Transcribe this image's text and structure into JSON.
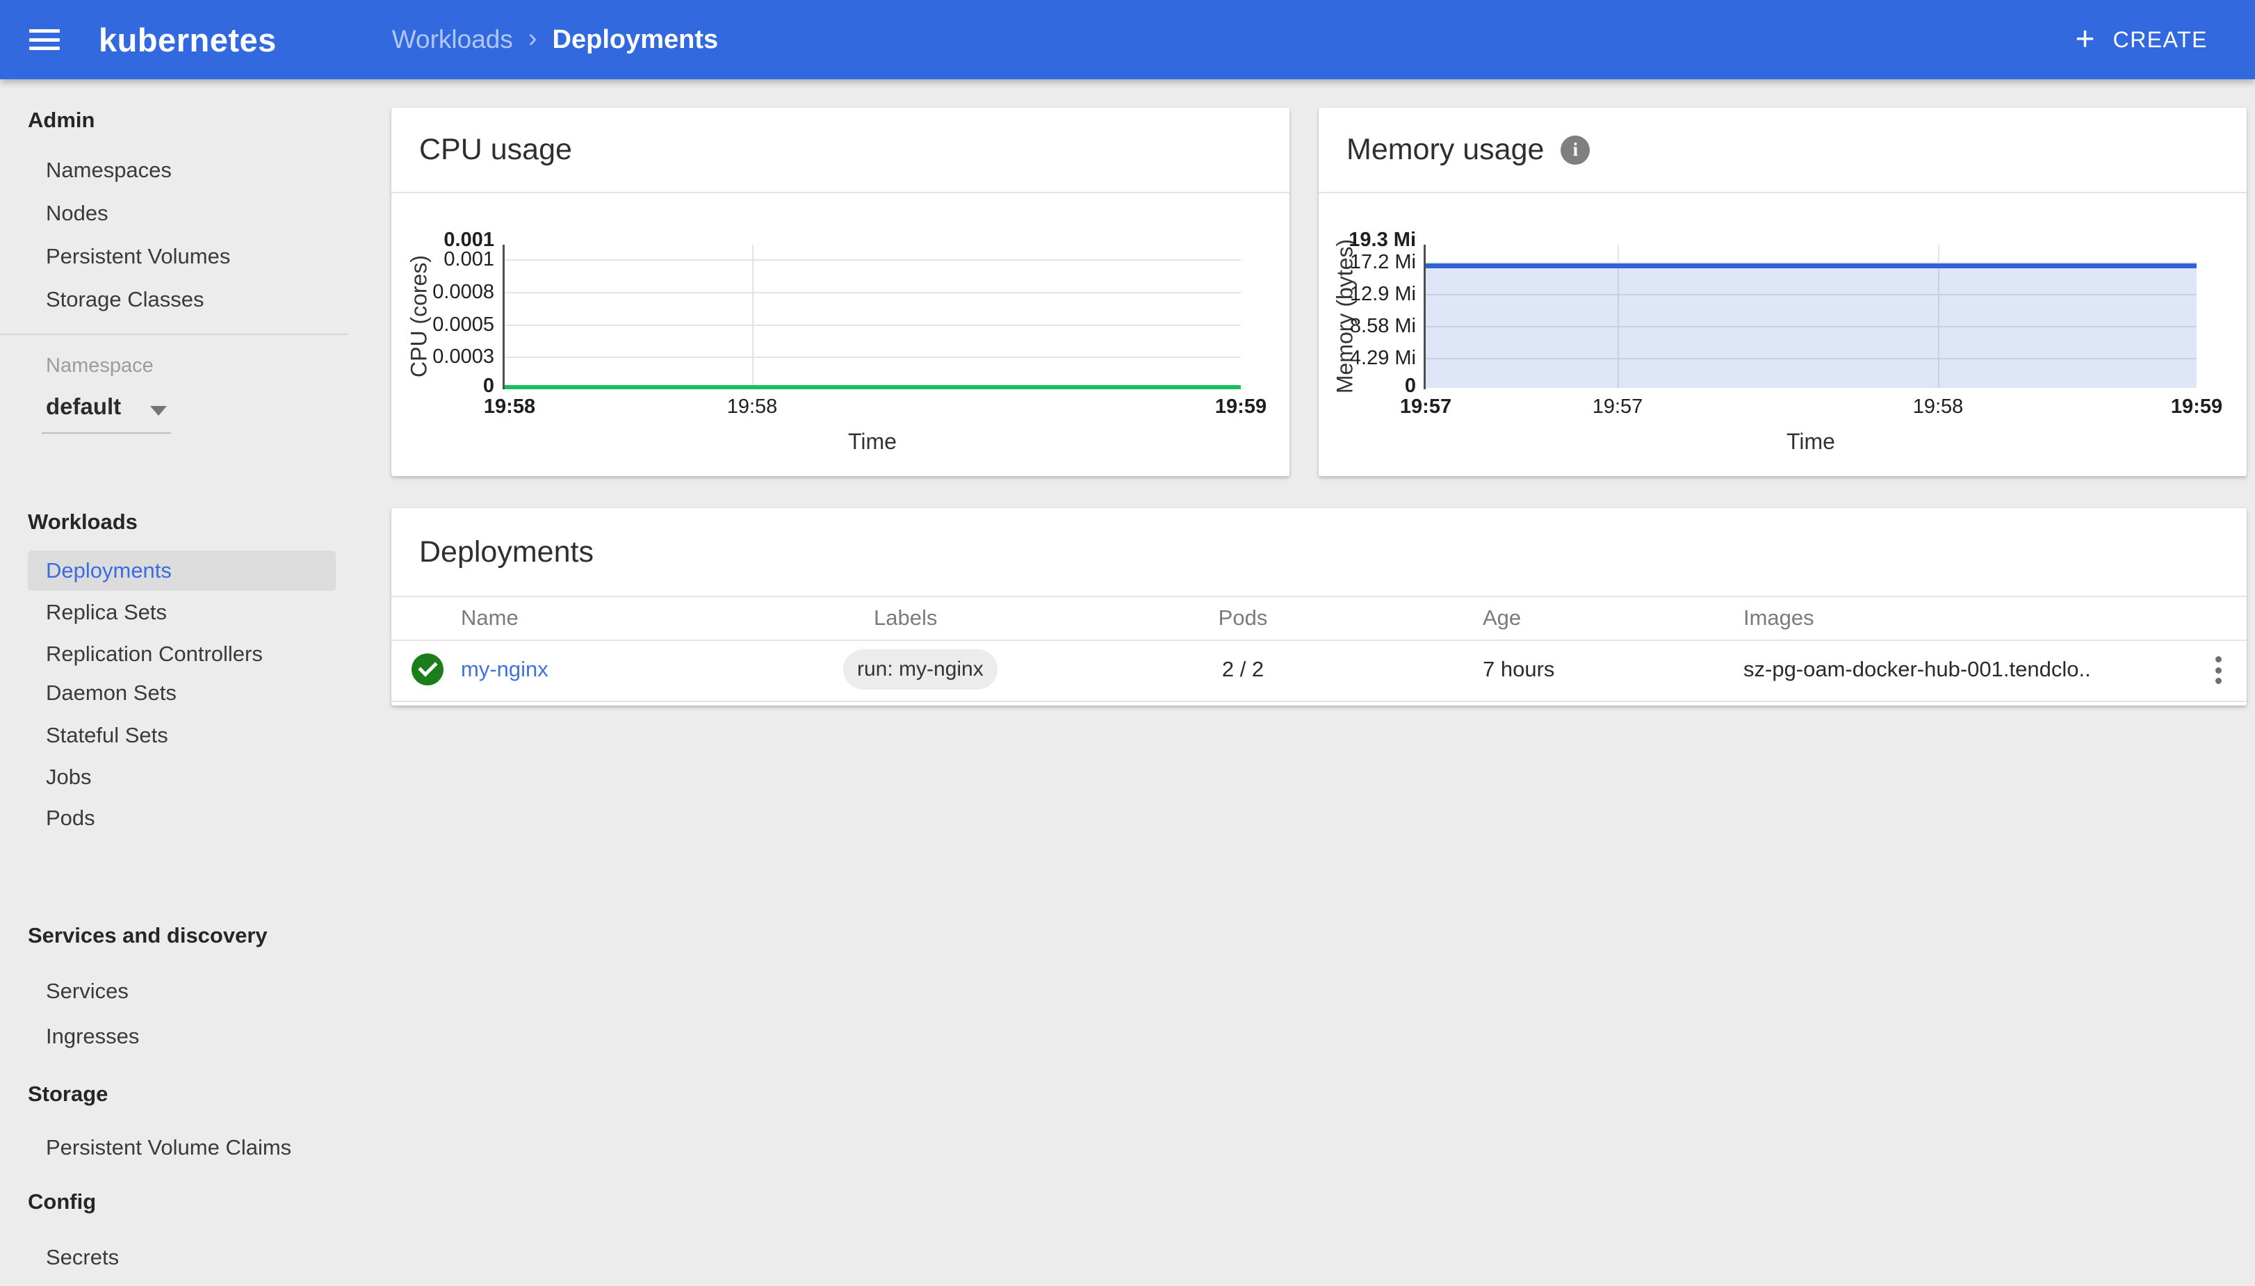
{
  "topbar": {
    "brand": "kubernetes",
    "breadcrumb_parent": "Workloads",
    "breadcrumb_current": "Deployments",
    "create_label": "CREATE",
    "color": "#3269de"
  },
  "sidebar": {
    "sections": [
      {
        "header": "Admin",
        "items": [
          "Namespaces",
          "Nodes",
          "Persistent Volumes",
          "Storage Classes"
        ]
      },
      {
        "header": "Workloads",
        "items": [
          "Deployments",
          "Replica Sets",
          "Replication Controllers",
          "Daemon Sets",
          "Stateful Sets",
          "Jobs",
          "Pods"
        ],
        "active_item": "Deployments"
      },
      {
        "header": "Services and discovery",
        "items": [
          "Services",
          "Ingresses"
        ]
      },
      {
        "header": "Storage",
        "items": [
          "Persistent Volume Claims"
        ]
      },
      {
        "header": "Config",
        "items": [
          "Secrets"
        ]
      }
    ],
    "namespace_selector": {
      "label": "Namespace",
      "value": "default"
    },
    "active_color": "#3b6de0"
  },
  "table": {
    "title": "Deployments",
    "columns": [
      "Name",
      "Labels",
      "Pods",
      "Age",
      "Images"
    ],
    "rows": [
      {
        "status": "ok",
        "name": "my-nginx",
        "label_chip": "run: my-nginx",
        "pods": "2 / 2",
        "age": "7 hours",
        "images": "sz-pg-oam-docker-hub-001.tendclo.."
      }
    ]
  },
  "chart_data": [
    {
      "type": "line",
      "title": "CPU usage",
      "ylabel": "CPU (cores)",
      "xlabel": "Time",
      "y_ticks": [
        "0.001",
        "0.001",
        "0.0008",
        "0.0005",
        "0.0003",
        "0"
      ],
      "x_ticks": [
        "19:58",
        "19:58",
        "19:59"
      ],
      "ylim": [
        0,
        0.001
      ],
      "grid": true,
      "legend": "none",
      "series": [
        {
          "name": "CPU usage",
          "color": "#17c05b",
          "x": [
            "19:58",
            "19:58",
            "19:59"
          ],
          "values": [
            0,
            0,
            0
          ]
        }
      ]
    },
    {
      "type": "area",
      "title": "Memory usage",
      "ylabel": "Memory (bytes)",
      "xlabel": "Time",
      "y_ticks": [
        "19.3 Mi",
        "17.2 Mi",
        "12.9 Mi",
        "8.58 Mi",
        "4.29 Mi",
        "0"
      ],
      "x_ticks": [
        "19:57",
        "19:57",
        "19:58",
        "19:59"
      ],
      "ylim_mebibytes": [
        0,
        19.3
      ],
      "grid": true,
      "legend": "none",
      "series": [
        {
          "name": "Memory usage",
          "color": "#3164d3",
          "fill": "#d9e2f7",
          "x": [
            "19:57",
            "19:57",
            "19:58",
            "19:59"
          ],
          "values_mebibytes": [
            16.6,
            16.6,
            16.6,
            16.6
          ]
        }
      ]
    }
  ]
}
